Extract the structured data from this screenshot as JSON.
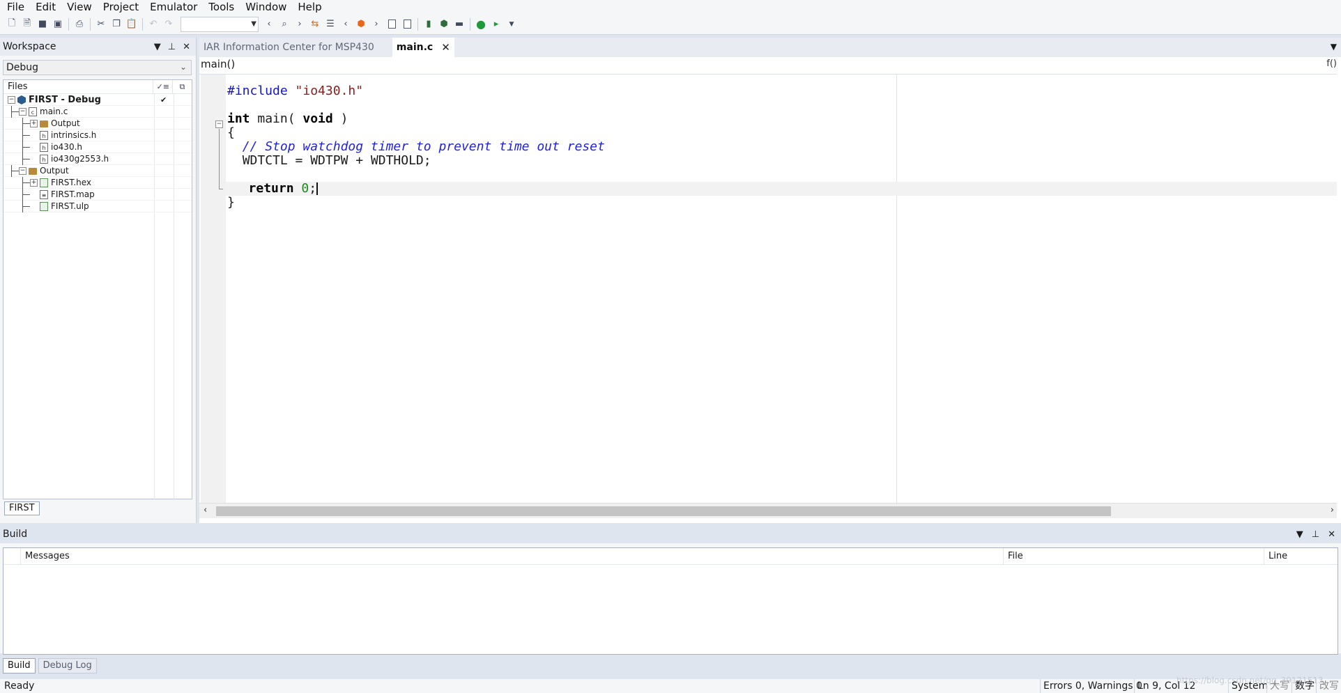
{
  "menu": [
    "File",
    "Edit",
    "View",
    "Project",
    "Emulator",
    "Tools",
    "Window",
    "Help"
  ],
  "toolbar": {
    "combo_value": "",
    "icons": [
      "new-file-icon",
      "new-doc-icon",
      "save-icon",
      "save-all-icon",
      "print-icon",
      "cut-icon",
      "copy-icon",
      "paste-icon",
      "undo-icon",
      "redo-icon",
      "find-previous-icon",
      "find-icon",
      "find-next-icon",
      "replace-icon",
      "goto-icon",
      "bookmark-previous-icon",
      "bookmark-toggle-icon",
      "bookmark-next-icon",
      "indent-left-icon",
      "indent-right-icon",
      "compile-icon",
      "make-icon",
      "stop-build-icon",
      "download-debug-icon",
      "debug-no-download-icon",
      "toolbar-overflow-icon"
    ]
  },
  "workspace": {
    "title": "Workspace",
    "configuration": "Debug",
    "files_header": "Files",
    "tab": "FIRST",
    "tree": [
      {
        "name": "FIRST - Debug",
        "kind": "project",
        "level": 0,
        "expand": "-",
        "bold": true,
        "check": "✔"
      },
      {
        "name": "main.c",
        "kind": "c-file",
        "level": 1,
        "expand": "-"
      },
      {
        "name": "Output",
        "kind": "folder",
        "level": 2,
        "expand": "+"
      },
      {
        "name": "intrinsics.h",
        "kind": "h-file",
        "level": 2,
        "expand": ""
      },
      {
        "name": "io430.h",
        "kind": "h-file",
        "level": 2,
        "expand": ""
      },
      {
        "name": "io430g2553.h",
        "kind": "h-file",
        "level": 2,
        "expand": ""
      },
      {
        "name": "Output",
        "kind": "folder",
        "level": 1,
        "expand": "-"
      },
      {
        "name": "FIRST.hex",
        "kind": "out-file",
        "level": 2,
        "expand": "+"
      },
      {
        "name": "FIRST.map",
        "kind": "map-file",
        "level": 2,
        "expand": ""
      },
      {
        "name": "FIRST.ulp",
        "kind": "out-file",
        "level": 2,
        "expand": ""
      }
    ]
  },
  "editor": {
    "tabs": [
      {
        "label": "IAR Information Center for MSP430",
        "active": false
      },
      {
        "label": "main.c",
        "active": true
      }
    ],
    "function": "main()",
    "code": {
      "line1_pre": "#include",
      "line1_str": "\"io430.h\"",
      "line3_kw1": "int",
      "line3_mid": " main( ",
      "line3_kw2": "void",
      "line3_end": " )",
      "line4": "{",
      "line5": "// Stop watchdog timer to prevent time out reset",
      "line6": "WDTCTL = WDTPW + WDTHOLD;",
      "line8_kw": "return",
      "line8_num": "0",
      "line8_end": ";",
      "line9": "}"
    },
    "cursor": {
      "line": 9,
      "col": 12
    }
  },
  "build": {
    "title": "Build",
    "columns": [
      "Messages",
      "File",
      "Line"
    ],
    "tabs": [
      {
        "label": "Build",
        "active": true
      },
      {
        "label": "Debug Log",
        "active": false
      }
    ]
  },
  "status": {
    "ready": "Ready",
    "errors": "Errors 0, Warnings 0",
    "position": "Ln 9, Col 12",
    "encoding": "System",
    "caps": "大写",
    "num": "数字",
    "overwrite": "改写",
    "watermark": "https://blog.csdn.net/qq_39121513"
  }
}
